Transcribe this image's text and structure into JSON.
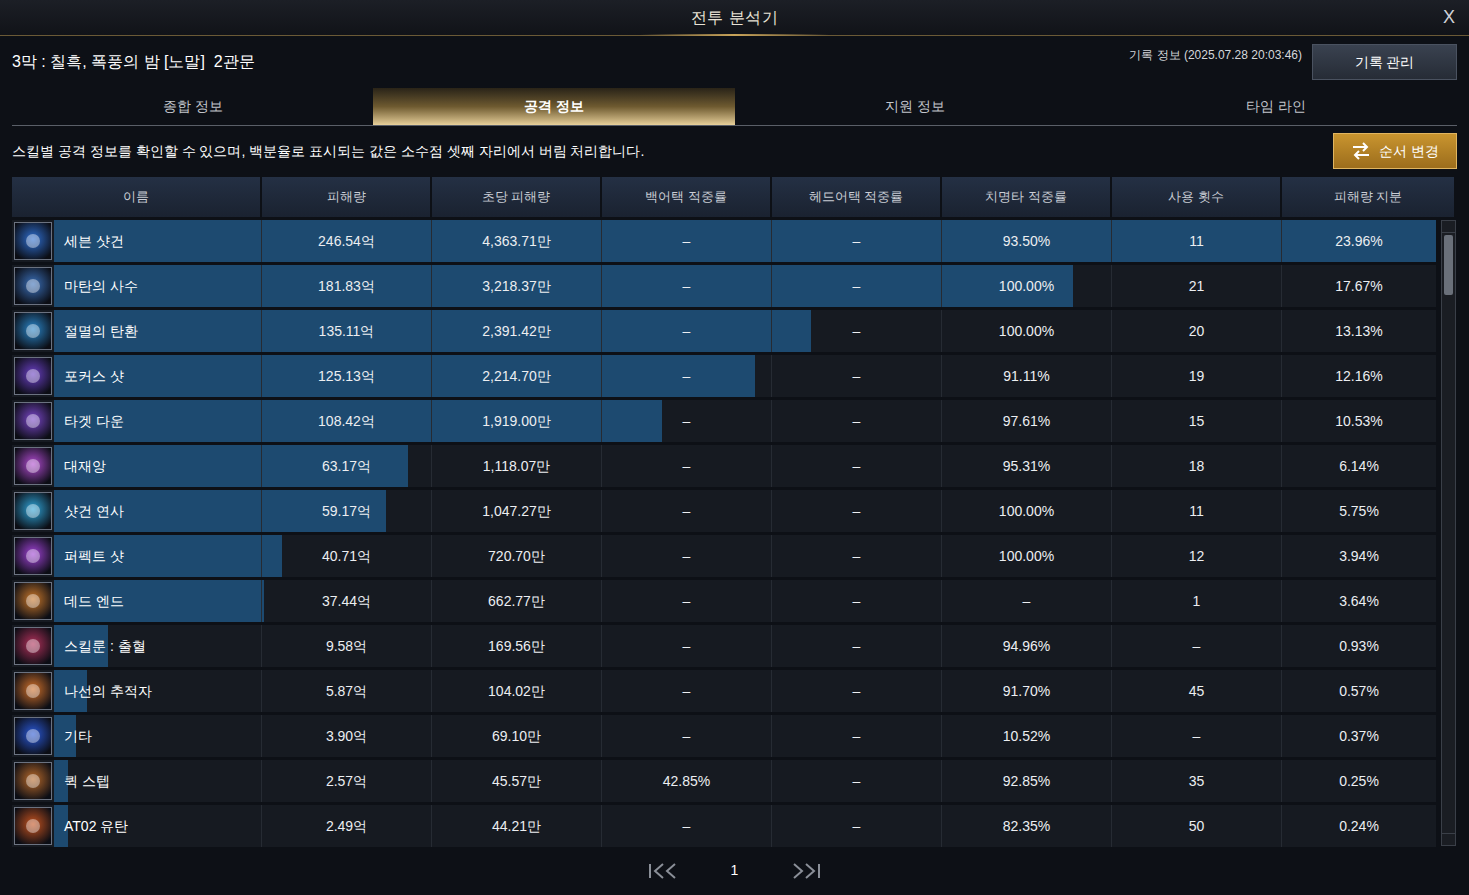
{
  "window": {
    "title": "전투 분석기",
    "close": "X"
  },
  "header": {
    "stage": "3막 : 칠흑, 폭풍의 밤 [노말]  2관문",
    "record_info": "기록 정보 (2025.07.28 20:03:46)",
    "manage_button": "기록 관리"
  },
  "tabs": [
    {
      "label": "종합 정보",
      "selected": false
    },
    {
      "label": "공격 정보",
      "selected": true
    },
    {
      "label": "지원 정보",
      "selected": false
    },
    {
      "label": "타임 라인",
      "selected": false
    }
  ],
  "description": "스킬별 공격 정보를 확인할 수 있으며, 백분율로 표시되는 값은 소수점 셋째 자리에서 버림 처리합니다.",
  "order_button": "순서 변경",
  "table": {
    "columns": [
      "이름",
      "피해량",
      "초당 피해량",
      "백어택 적중률",
      "헤드어택 적중률",
      "치명타 적중률",
      "사용 횟수",
      "피해량 지분"
    ],
    "rows": [
      {
        "name": "세븐 샷건",
        "cells": [
          "246.54억",
          "4,363.71만",
          "–",
          "–",
          "93.50%",
          "11",
          "23.96%"
        ],
        "level": 1,
        "color": "#2f6fd1"
      },
      {
        "name": "마탄의 사수",
        "cells": [
          "181.83억",
          "3,218.37만",
          "–",
          "–",
          "100.00%",
          "21",
          "17.67%"
        ],
        "level": 0.7375,
        "color": "#3a6fb8"
      },
      {
        "name": "절멸의 탄환",
        "cells": [
          "135.11억",
          "2,391.42만",
          "–",
          "–",
          "100.00%",
          "20",
          "13.13%"
        ],
        "level": 0.548,
        "color": "#2a86c9"
      },
      {
        "name": "포커스 샷",
        "cells": [
          "125.13억",
          "2,214.70만",
          "–",
          "–",
          "91.11%",
          "19",
          "12.16%"
        ],
        "level": 0.5075,
        "color": "#6a3fc4"
      },
      {
        "name": "타겟 다운",
        "cells": [
          "108.42억",
          "1,919.00만",
          "–",
          "–",
          "97.61%",
          "15",
          "10.53%"
        ],
        "level": 0.4398,
        "color": "#7a46c9"
      },
      {
        "name": "대재앙",
        "cells": [
          "63.17억",
          "1,118.07만",
          "–",
          "–",
          "95.31%",
          "18",
          "6.14%"
        ],
        "level": 0.2562,
        "color": "#b04ad0"
      },
      {
        "name": "샷건 연사",
        "cells": [
          "59.17억",
          "1,047.27만",
          "–",
          "–",
          "100.00%",
          "11",
          "5.75%"
        ],
        "level": 0.24,
        "color": "#2fa4d8"
      },
      {
        "name": "퍼펙트 샷",
        "cells": [
          "40.71억",
          "720.70만",
          "–",
          "–",
          "100.00%",
          "12",
          "3.94%"
        ],
        "level": 0.1651,
        "color": "#a042d6"
      },
      {
        "name": "데드 엔드",
        "cells": [
          "37.44억",
          "662.77만",
          "–",
          "–",
          "–",
          "1",
          "3.64%"
        ],
        "level": 0.1519,
        "color": "#c9772a"
      },
      {
        "name": "스킬룬 : 출혈",
        "cells": [
          "9.58억",
          "169.56만",
          "–",
          "–",
          "94.96%",
          "–",
          "0.93%"
        ],
        "level": 0.0389,
        "color": "#b0305a"
      },
      {
        "name": "나선의 추적자",
        "cells": [
          "5.87억",
          "104.02만",
          "–",
          "–",
          "91.70%",
          "45",
          "0.57%"
        ],
        "level": 0.0238,
        "color": "#d0702a"
      },
      {
        "name": "기타",
        "cells": [
          "3.90억",
          "69.10만",
          "–",
          "–",
          "10.52%",
          "–",
          "0.37%"
        ],
        "level": 0.0158,
        "color": "#2a58d6"
      },
      {
        "name": "퀵 스텝",
        "cells": [
          "2.57억",
          "45.57만",
          "42.85%",
          "–",
          "92.85%",
          "35",
          "0.25%"
        ],
        "level": 0.0104,
        "color": "#b8692a"
      },
      {
        "name": "AT02 유탄",
        "cells": [
          "2.49억",
          "44.21만",
          "–",
          "–",
          "82.35%",
          "50",
          "0.24%"
        ],
        "level": 0.0101,
        "color": "#c4521f"
      }
    ]
  },
  "scrollbar": {
    "level": 0.1
  },
  "pagination": {
    "page": "1"
  }
}
